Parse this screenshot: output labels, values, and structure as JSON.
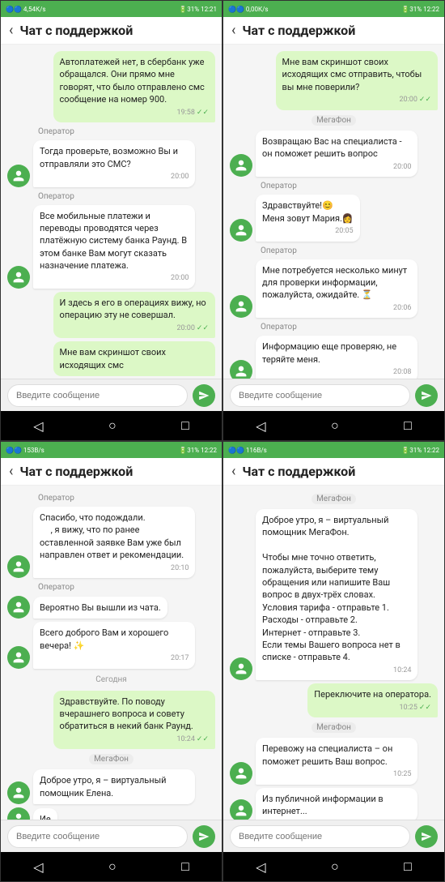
{
  "panels": [
    {
      "id": "panel-1",
      "status": {
        "left": "🔵🔵 4,54К/s",
        "right": "🔋31% 12:21"
      },
      "title": "Чат с поддержкой",
      "messages": [
        {
          "type": "outgoing",
          "text": "Автоплатежей нет, в сбербанк уже обращался. Они прямо мне говорят, что было отправлено смс сообщение на номер 900.",
          "time": "19:58",
          "checks": true
        },
        {
          "type": "sender",
          "label": "Оператор"
        },
        {
          "type": "incoming",
          "text": "Тогда проверьте, возможно Вы и отправляли это СМС?",
          "time": "20:00"
        },
        {
          "type": "sender",
          "label": "Оператор"
        },
        {
          "type": "incoming",
          "text": "Все мобильные платежи и переводы проводятся через платёжную систему банка Раунд. В этом банке Вам могут сказать назначение платежа.",
          "time": "20:00"
        },
        {
          "type": "outgoing",
          "text": "И здесь я его в операциях вижу, но операцию эту не совершал.",
          "time": "20:00",
          "checks": true
        },
        {
          "type": "outgoing",
          "text": "Мне вам скриншот своих исходящих смс",
          "time": "",
          "checks": false,
          "partial": true
        }
      ],
      "input_placeholder": "Введите сообщение"
    },
    {
      "id": "panel-2",
      "status": {
        "left": "🔵🔵 0,00К/s",
        "right": "🔋31% 12:22"
      },
      "title": "Чат с поддержкой",
      "messages": [
        {
          "type": "outgoing",
          "text": "Мне вам скриншот своих исходящих смс отправить, чтобы вы мне поверили?",
          "time": "20:00",
          "checks": true
        },
        {
          "type": "megafon",
          "label": "МегаФон"
        },
        {
          "type": "incoming",
          "text": "Возвращаю Вас на специалиста - он поможет решить вопрос",
          "time": "20:00"
        },
        {
          "type": "sender",
          "label": "Оператор"
        },
        {
          "type": "incoming",
          "text": "Здравствуйте!😊\nМеня зовут Мария.👩",
          "time": "20:05"
        },
        {
          "type": "sender",
          "label": "Оператор"
        },
        {
          "type": "incoming",
          "text": "Мне потребуется несколько минут для проверки информации, пожалуйста, ожидайте. ⏳",
          "time": "20:06"
        },
        {
          "type": "sender",
          "label": "Оператор"
        },
        {
          "type": "incoming",
          "text": "Информацию еще проверяю, не теряйте меня.",
          "time": "20:08"
        }
      ],
      "input_placeholder": "Введите сообщение"
    },
    {
      "id": "panel-3",
      "status": {
        "left": "🔵🔵 153В/s",
        "right": "🔋31% 12:22"
      },
      "title": "Чат с поддержкой",
      "messages": [
        {
          "type": "sender",
          "label": "Оператор"
        },
        {
          "type": "incoming",
          "text": "Спасибо, что подождали.\n     , я вижу, что по ранее оставленной заявке Вам уже был направлен ответ и рекомендации.",
          "time": "20:10"
        },
        {
          "type": "sender",
          "label": "Оператор"
        },
        {
          "type": "incoming",
          "text": "Вероятно Вы вышли из чата.",
          "time": ""
        },
        {
          "type": "incoming",
          "text": "Всего доброго Вам и хорошего вечера! ✨",
          "time": "20:17"
        },
        {
          "type": "date",
          "label": "Сегодня"
        },
        {
          "type": "outgoing",
          "text": "Здравствуйте. По поводу вчерашнего вопроса и совету обратиться в некий банк Раунд.",
          "time": "10:24",
          "checks": true
        },
        {
          "type": "megafon",
          "label": "МегаФон"
        },
        {
          "type": "incoming",
          "text": "Доброе утро, я – виртуальный помощник Елена.",
          "time": ""
        },
        {
          "type": "incoming_partial",
          "text": "Ие",
          "time": ""
        }
      ],
      "input_placeholder": "Введите сообщение"
    },
    {
      "id": "panel-4",
      "status": {
        "left": "🔵🔵 116В/s",
        "right": "🔋31% 12:22"
      },
      "title": "Чат с поддержкой",
      "messages": [
        {
          "type": "megafon",
          "label": "МегаФон"
        },
        {
          "type": "incoming",
          "text": "Доброе утро, я – виртуальный помощник МегаФон.\n\nЧтобы мне точно ответить, пожалуйста, выберите тему обращения или напишите Ваш вопрос в двух-трёх словах.\nУсловия тарифа - отправьте 1.\nРасходы - отправьте 2.\nИнтернет - отправьте 3.\nЕсли темы Вашего вопроса нет в списке - отправьте 4.",
          "time": "10:24"
        },
        {
          "type": "outgoing",
          "text": "Переключите на оператора.",
          "time": "10:25",
          "checks": true
        },
        {
          "type": "megafon",
          "label": "МегаФон"
        },
        {
          "type": "incoming",
          "text": "Перевожу на специалиста – он поможет решить Ваш вопрос.",
          "time": "10:25"
        },
        {
          "type": "incoming_partial",
          "text": "Из публичной информации в интернет...",
          "time": ""
        }
      ],
      "input_placeholder": "Введите сообщение"
    }
  ],
  "nav": {
    "back": "◁",
    "home": "○",
    "recent": "□"
  },
  "send_label": "↑"
}
